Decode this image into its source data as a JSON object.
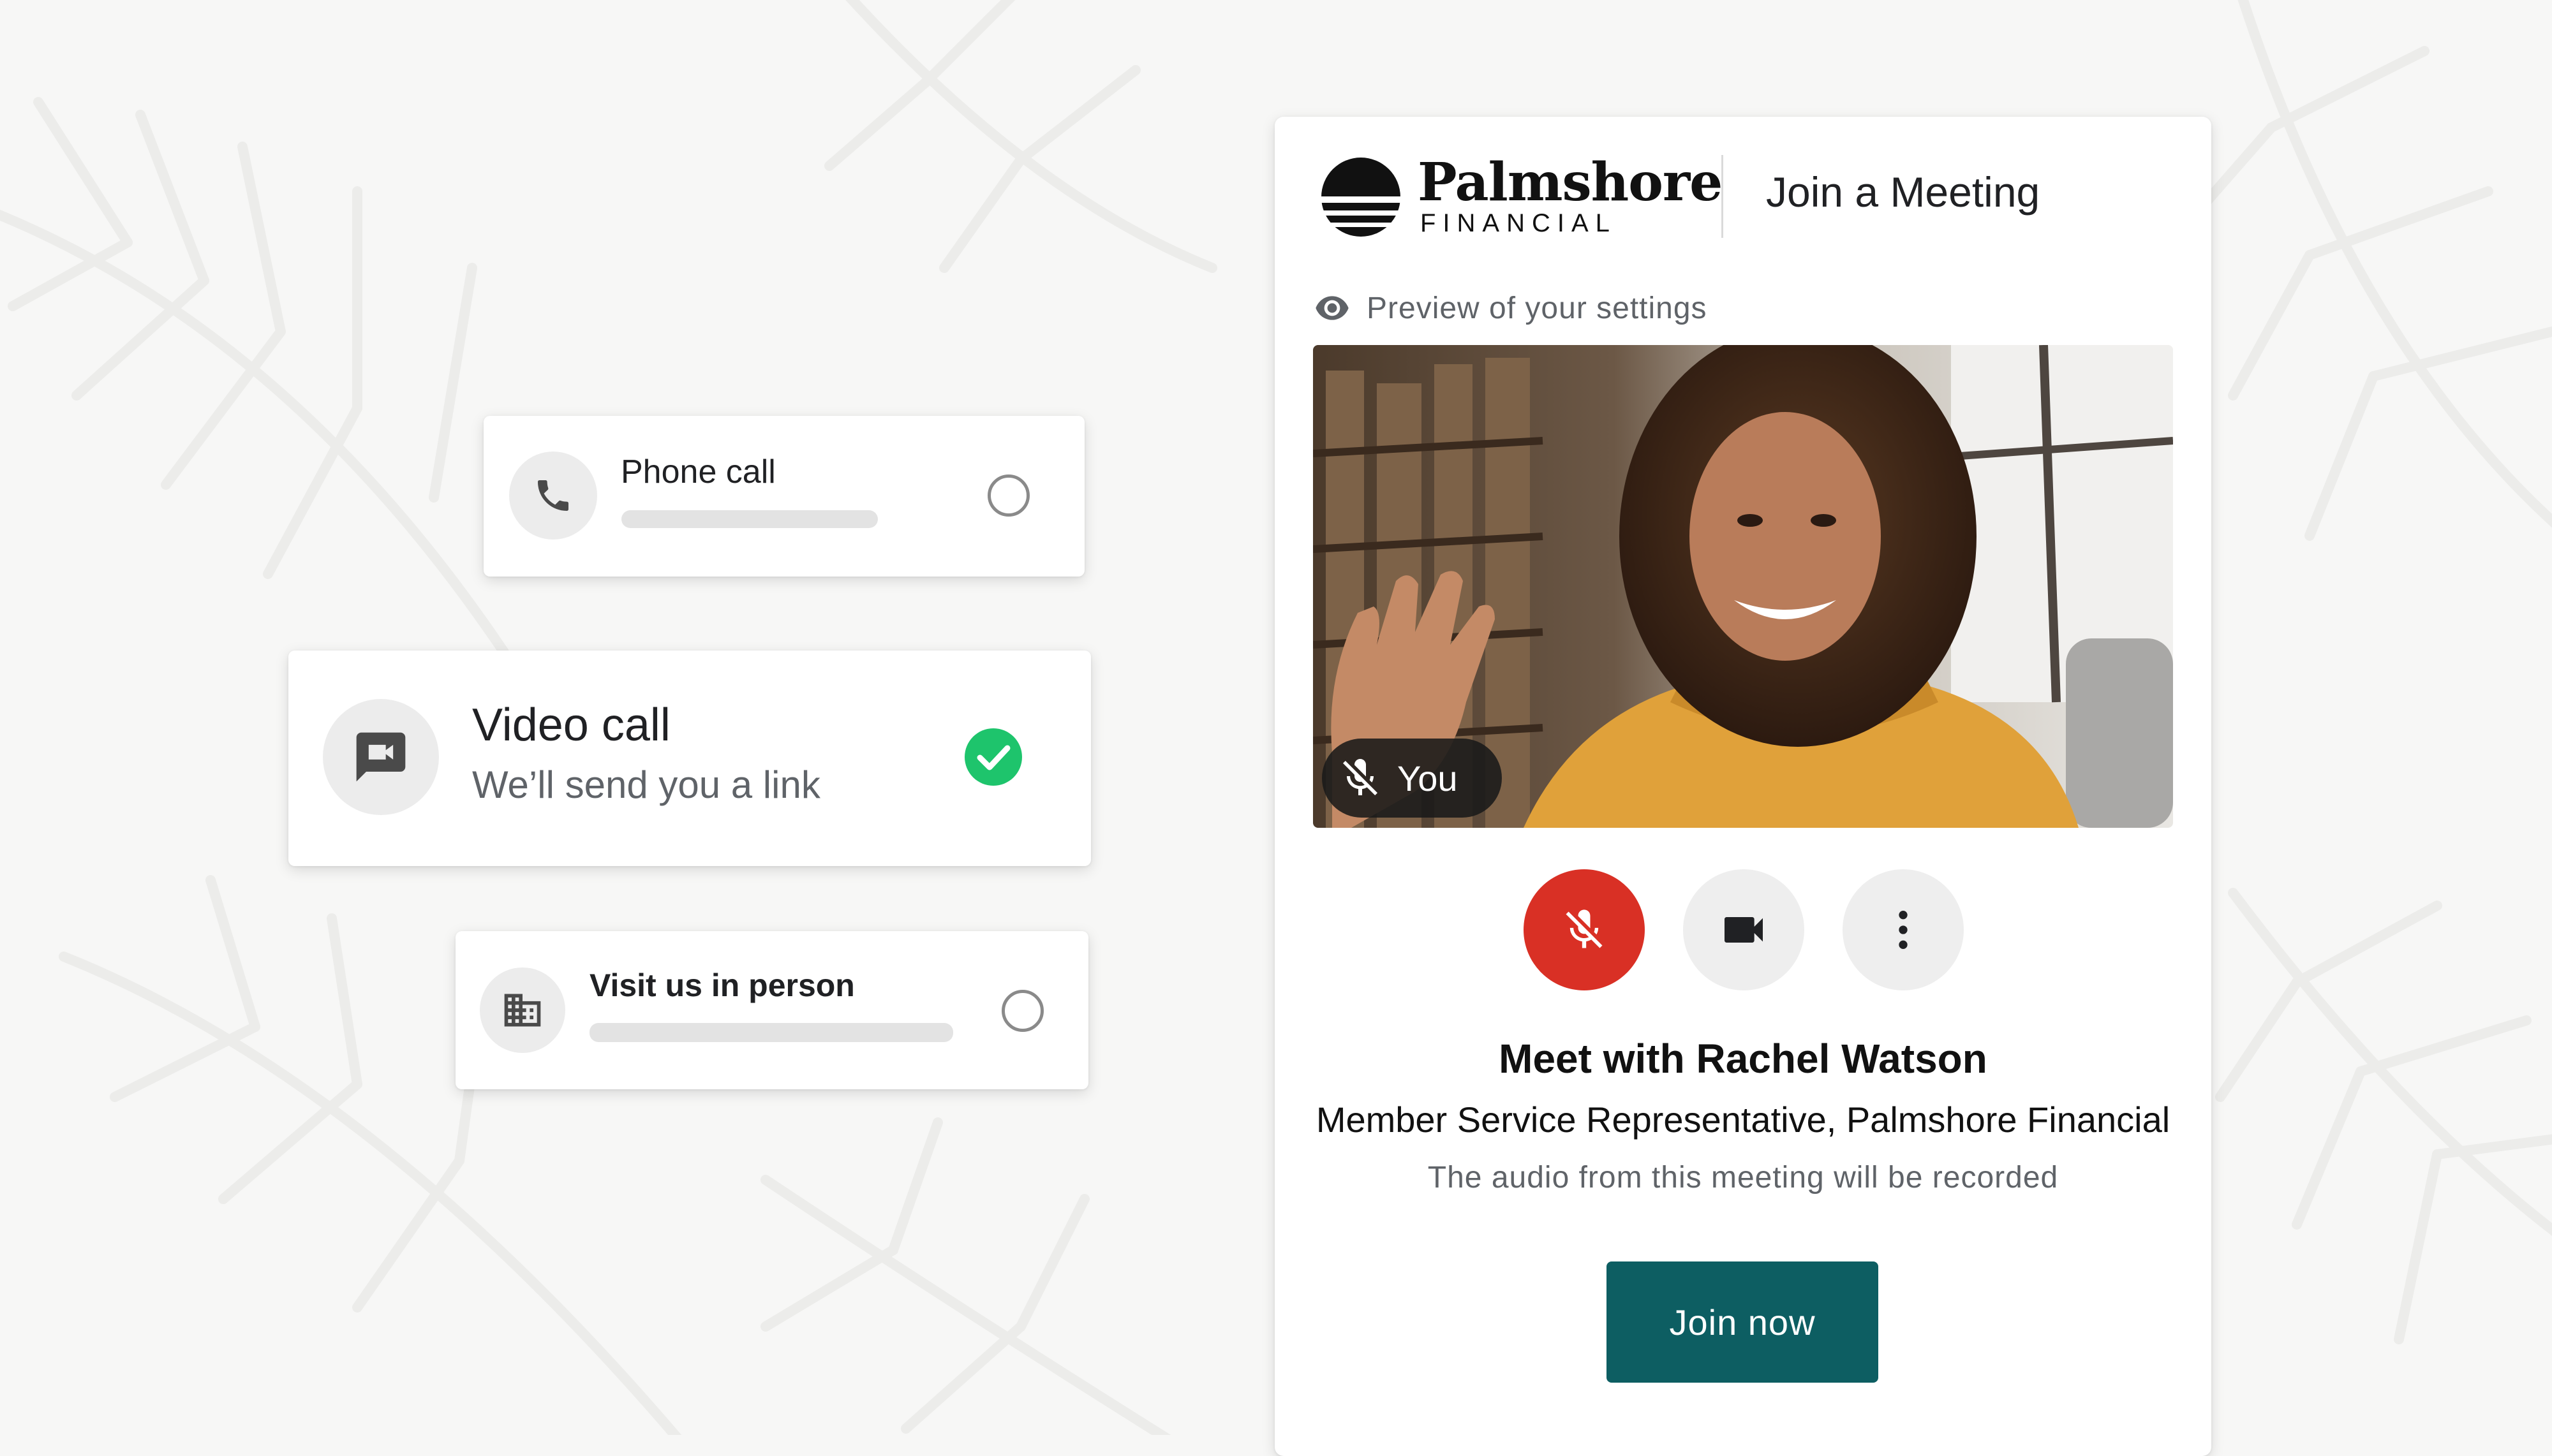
{
  "options": {
    "phone": {
      "title": "Phone call",
      "selected": false,
      "icon": "phone-icon"
    },
    "video": {
      "title": "Video call",
      "subtitle": "We’ll send you a link",
      "selected": true,
      "icon": "video-chat-icon"
    },
    "in_person": {
      "title": "Visit us in person",
      "selected": false,
      "icon": "building-icon"
    }
  },
  "panel": {
    "brand_name": "Palmshore",
    "brand_sub": "FINANCIAL",
    "title": "Join a Meeting",
    "preview_label": "Preview of your settings",
    "self_label": "You",
    "controls": [
      {
        "name": "microphone",
        "state": "muted",
        "color": "#d93025"
      },
      {
        "name": "camera",
        "state": "on"
      },
      {
        "name": "more-options"
      }
    ],
    "meeting_title": "Meet with Rachel Watson",
    "meeting_subtitle": "Member Service Representative, Palmshore Financial",
    "recording_note": "The audio from this meeting will be recorded",
    "join_label": "Join now"
  },
  "colors": {
    "accent": "#0d5e62",
    "selected_check": "#1ec46c",
    "mute_red": "#d93025",
    "background": "#f7f7f6"
  }
}
